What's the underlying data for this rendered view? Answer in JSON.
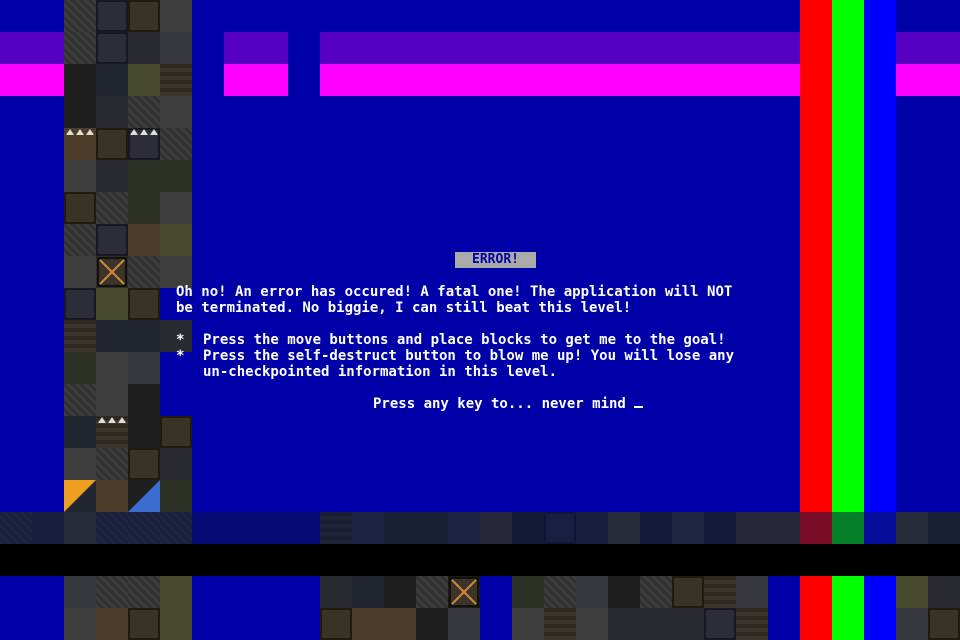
{
  "dialog": {
    "title": "ERROR!",
    "line1": "Oh no! An error has occured! A fatal one! The application will NOT",
    "line2": "be terminated. No biggie, I can still beat this level!",
    "bullet": "*",
    "tip1_line1": "Press the move buttons and place blocks to get me to the goal!",
    "tip2_line1": "Press the self-destruct button to blow me up! You will lose any",
    "tip2_line2": "un-checkpointed information in this level.",
    "prompt": "Press any key to... never mind"
  },
  "colors": {
    "background": "#0000a8",
    "stripe_red": "#ff0000",
    "stripe_green": "#00ff00",
    "stripe_blue": "#0000ff",
    "band_purple": "#5500c0",
    "band_magenta": "#ff00ff"
  },
  "icons": [
    "spike-icon",
    "crate-icon",
    "rock-icon"
  ]
}
